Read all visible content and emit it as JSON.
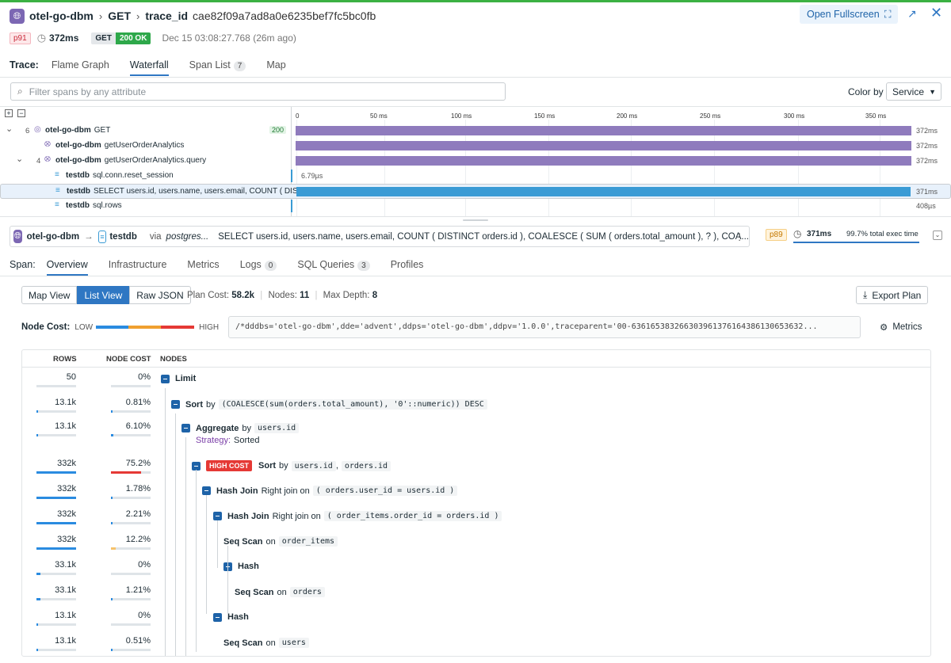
{
  "header": {
    "service": "otel-go-dbm",
    "method": "GET",
    "trace_label": "trace_id",
    "trace_id": "cae82f09a7ad8a0e6235bef7fc5bc0fb",
    "fullscreen_label": "Open Fullscreen"
  },
  "meta": {
    "percentile": "p91",
    "duration": "372ms",
    "http_method": "GET",
    "status": "200 OK",
    "timestamp": "Dec 15 03:08:27.768 (26m ago)"
  },
  "trace_tabs": {
    "label": "Trace:",
    "items": [
      {
        "label": "Flame Graph"
      },
      {
        "label": "Waterfall"
      },
      {
        "label": "Span List",
        "count": "7"
      },
      {
        "label": "Map"
      }
    ]
  },
  "filter": {
    "placeholder": "Filter spans by any attribute"
  },
  "color_by": {
    "label": "Color by",
    "value": "Service"
  },
  "timeline_ticks": [
    "0",
    "50 ms",
    "100 ms",
    "150 ms",
    "200 ms",
    "250 ms",
    "300 ms",
    "350 ms"
  ],
  "spans": [
    {
      "count": "6",
      "service": "otel-go-dbm",
      "resource": "GET",
      "status": "200",
      "duration": "372ms",
      "color": "#8f7bbd"
    },
    {
      "count": "",
      "service": "otel-go-dbm",
      "resource": "getUserOrderAnalytics",
      "status": "",
      "duration": "372ms",
      "color": "#8f7bbd"
    },
    {
      "count": "4",
      "service": "otel-go-dbm",
      "resource": "getUserOrderAnalytics.query",
      "status": "",
      "duration": "372ms",
      "color": "#8f7bbd"
    },
    {
      "count": "",
      "service": "testdb",
      "resource": "sql.conn.reset_session",
      "status": "",
      "duration": "6.79µs",
      "color": "#3a9bd5"
    },
    {
      "count": "",
      "service": "testdb",
      "resource": "SELECT users.id, users.name, users.email, COUNT ( DIS...",
      "status": "",
      "duration": "371ms",
      "color": "#3a9bd5"
    },
    {
      "count": "",
      "service": "testdb",
      "resource": "sql.rows",
      "status": "",
      "duration": "408µs",
      "color": "#3a9bd5"
    }
  ],
  "span_header": {
    "from": "otel-go-dbm",
    "to": "testdb",
    "via": "via",
    "via_value": "postgres...",
    "query": "SELECT users.id, users.name, users.email, COUNT ( DISTINCT orders.id ), COALESCE ( SUM ( orders.total_amount ), ? ), COA...",
    "percentile": "p89",
    "duration": "371ms",
    "exec_share": "99.7% total exec time",
    "exec_fraction": 0.997
  },
  "span_tabs": {
    "label": "Span:",
    "items": [
      {
        "label": "Overview"
      },
      {
        "label": "Infrastructure"
      },
      {
        "label": "Metrics"
      },
      {
        "label": "Logs",
        "count": "0"
      },
      {
        "label": "SQL Queries",
        "count": "3"
      },
      {
        "label": "Profiles"
      }
    ]
  },
  "plan": {
    "views": [
      "Map View",
      "List View",
      "Raw JSON"
    ],
    "plan_cost_label": "Plan Cost:",
    "plan_cost": "58.2k",
    "nodes_label": "Nodes:",
    "nodes": "11",
    "depth_label": "Max Depth:",
    "depth": "8",
    "export_label": "Export Plan",
    "node_cost_label": "Node Cost:",
    "low": "LOW",
    "high": "HIGH",
    "sql_comment": "/*dddbs='otel-go-dbm',dde='advent',ddps='otel-go-dbm',ddpv='1.0.0',traceparent='00-636165383266303961376164386130653632...",
    "metrics_label": "Metrics",
    "columns": [
      "ROWS",
      "NODE COST",
      "NODES"
    ],
    "high_cost_label": "HIGH COST",
    "rows": [
      {
        "rows": "50",
        "rows_frac": 0.0,
        "cost": "0%",
        "cost_frac": 0.0,
        "op": "Limit",
        "pre": "",
        "detail": "",
        "strategy": ""
      },
      {
        "rows": "13.1k",
        "rows_frac": 0.04,
        "cost": "0.81%",
        "cost_frac": 0.01,
        "op": "Sort",
        "pre": "by",
        "detail": "(COALESCE(sum(orders.total_amount), '0'::numeric)) DESC",
        "strategy": ""
      },
      {
        "rows": "13.1k",
        "rows_frac": 0.04,
        "cost": "6.10%",
        "cost_frac": 0.06,
        "op": "Aggregate",
        "pre": "by",
        "detail": "users.id",
        "strategy_label": "Strategy:",
        "strategy": "Sorted"
      },
      {
        "rows": "332k",
        "rows_frac": 1.0,
        "cost": "75.2%",
        "cost_frac": 0.75,
        "op": "Sort",
        "pre": "by",
        "detail": "users.id",
        "detail2": "orders.id",
        "strategy": ""
      },
      {
        "rows": "332k",
        "rows_frac": 1.0,
        "cost": "1.78%",
        "cost_frac": 0.02,
        "op": "Hash Join",
        "pre": "Right join on",
        "detail": "( orders.user_id = users.id )",
        "strategy": ""
      },
      {
        "rows": "332k",
        "rows_frac": 1.0,
        "cost": "2.21%",
        "cost_frac": 0.02,
        "op": "Hash Join",
        "pre": "Right join on",
        "detail": "( order_items.order_id = orders.id )",
        "strategy": ""
      },
      {
        "rows": "332k",
        "rows_frac": 1.0,
        "cost": "12.2%",
        "cost_frac": 0.12,
        "op": "Seq Scan",
        "pre": "on",
        "detail": "order_items",
        "strategy": ""
      },
      {
        "rows": "33.1k",
        "rows_frac": 0.1,
        "cost": "0%",
        "cost_frac": 0.0,
        "op": "Hash",
        "pre": "",
        "detail": "",
        "strategy": ""
      },
      {
        "rows": "33.1k",
        "rows_frac": 0.1,
        "cost": "1.21%",
        "cost_frac": 0.01,
        "op": "Seq Scan",
        "pre": "on",
        "detail": "orders",
        "strategy": ""
      },
      {
        "rows": "13.1k",
        "rows_frac": 0.04,
        "cost": "0%",
        "cost_frac": 0.0,
        "op": "Hash",
        "pre": "",
        "detail": "",
        "strategy": ""
      },
      {
        "rows": "13.1k",
        "rows_frac": 0.04,
        "cost": "0.51%",
        "cost_frac": 0.005,
        "op": "Seq Scan",
        "pre": "on",
        "detail": "users",
        "strategy": ""
      }
    ]
  },
  "colors": {
    "accent": "#2f77c3",
    "service_purple": "#8f7bbd",
    "db_blue": "#3a9bd5",
    "high_cost": "#e53935",
    "ok_green": "#2ea84a"
  }
}
